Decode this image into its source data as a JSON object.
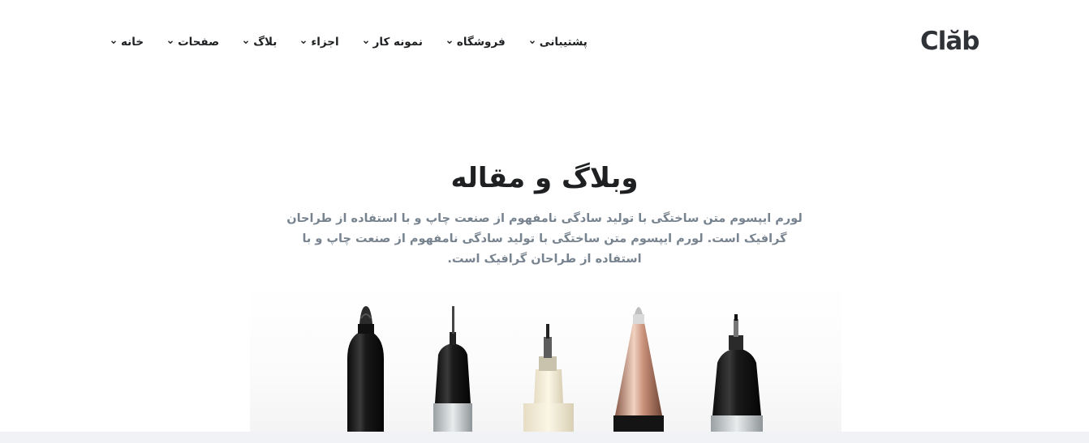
{
  "header": {
    "logo": "Clăb",
    "nav": [
      {
        "label": "خانه"
      },
      {
        "label": "صفحات"
      },
      {
        "label": "بلاگ"
      },
      {
        "label": "اجزاء"
      },
      {
        "label": "نمونه کار"
      },
      {
        "label": "فروشگاه"
      },
      {
        "label": "پشتیبانی"
      }
    ]
  },
  "hero": {
    "title": "وبلاگ و مقاله",
    "text": "لورم ایپسوم متن ساختگی با تولید سادگی نامفهوم از صنعت چاپ و با استفاده از طراحان گرافیک است. لورم ایپسوم متن ساختگی با تولید سادگی نامفهوم از صنعت چاپ و با استفاده از طراحان گرافیک است."
  },
  "icons": {
    "chevron": "chevron-down-icon"
  },
  "colors": {
    "text_dark": "#1e2022",
    "text_muted": "#77838f",
    "footer_strip": "#f1f2f6"
  }
}
